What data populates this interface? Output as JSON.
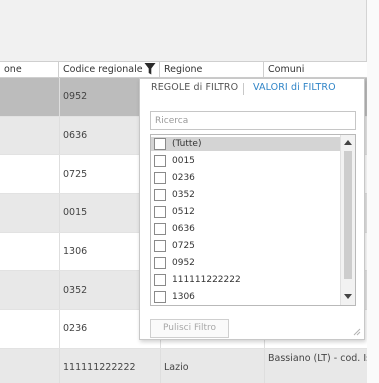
{
  "columns": [
    {
      "label": "one"
    },
    {
      "label": "Codice regionale"
    },
    {
      "label": "Regione"
    },
    {
      "label": "Comuni"
    }
  ],
  "rows": [
    {
      "codice": "0952",
      "regione": "",
      "comuni": ""
    },
    {
      "codice": "0636",
      "regione": "",
      "comuni": ""
    },
    {
      "codice": "0725",
      "regione": "",
      "comuni": ""
    },
    {
      "codice": "0015",
      "regione": "",
      "comuni": ""
    },
    {
      "codice": "1306",
      "regione": "",
      "comuni": ""
    },
    {
      "codice": "0352",
      "regione": "",
      "comuni": ""
    },
    {
      "codice": "0236",
      "regione": "",
      "comuni": ""
    },
    {
      "codice": "111111222222",
      "regione": "Lazio",
      "comuni": "Bassiano (LT) - cod. Is"
    }
  ],
  "filter_popup": {
    "tabs": {
      "rules": "REGOLE di FILTRO",
      "values": "VALORI di FILTRO"
    },
    "active_tab": "values",
    "search": {
      "placeholder": "Ricerca",
      "value": ""
    },
    "options": [
      {
        "label": "(Tutte)",
        "checked": false
      },
      {
        "label": "0015",
        "checked": false
      },
      {
        "label": "0236",
        "checked": false
      },
      {
        "label": "0352",
        "checked": false
      },
      {
        "label": "0512",
        "checked": false
      },
      {
        "label": "0636",
        "checked": false
      },
      {
        "label": "0725",
        "checked": false
      },
      {
        "label": "0952",
        "checked": false
      },
      {
        "label": "111111222222",
        "checked": false
      },
      {
        "label": "1306",
        "checked": false
      }
    ],
    "clear_button": "Pulisci Filtro"
  },
  "colors": {
    "accent": "#2f84c7",
    "row_selected": "#bcbcbc",
    "row_alt": "#e8e8e8",
    "topbar": "#f1f1f1"
  },
  "icons": [
    "filter-funnel-icon",
    "scroll-up-icon",
    "scroll-down-icon",
    "resize-grip-icon"
  ]
}
